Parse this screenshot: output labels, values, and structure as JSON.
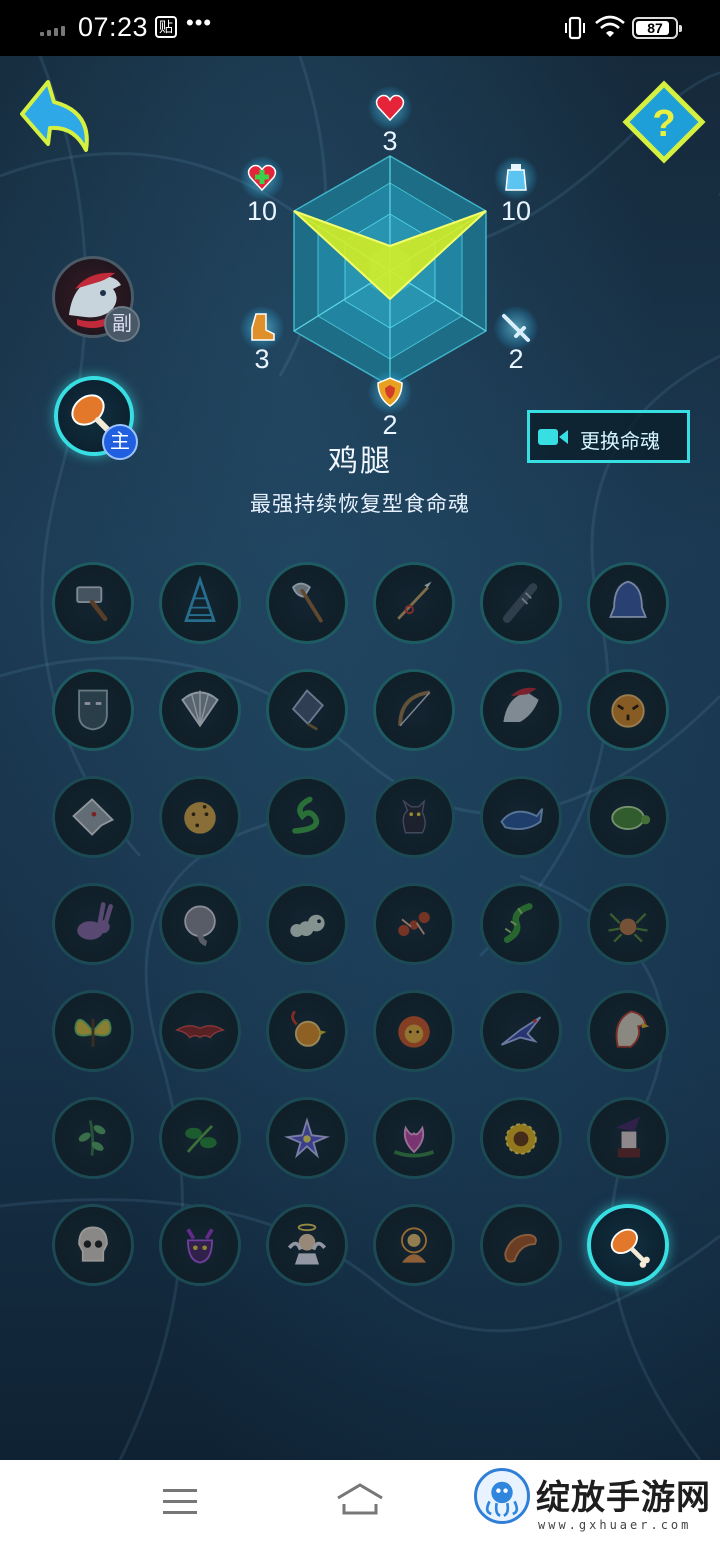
{
  "status_bar": {
    "time": "07:23",
    "tie_icon_label": "贴",
    "more": "•••",
    "battery": "87",
    "battery_fraction": 0.87
  },
  "stats": {
    "hp": "3",
    "mana": "10",
    "attack": "2",
    "defense": "2",
    "speed": "3",
    "regen": "10"
  },
  "soul_slots": {
    "sub_badge": "副",
    "main_badge": "主"
  },
  "swap_button": {
    "label": "更换命魂"
  },
  "selected_soul": {
    "name": "鸡腿",
    "description": "最强持续恢复型食命魂"
  },
  "soul_grid": {
    "rows": [
      [
        "hammer",
        "tree",
        "axe",
        "spear",
        "club",
        "bell"
      ],
      [
        "mask",
        "shell",
        "fan",
        "bow",
        "dragon",
        "tiger"
      ],
      [
        "wolf",
        "leopard",
        "snake",
        "cat",
        "whale",
        "turtle"
      ],
      [
        "rabbit",
        "elephant",
        "worm",
        "ant",
        "centipede",
        "spider"
      ],
      [
        "butterfly",
        "bat",
        "phoenix-chick",
        "lion-flame",
        "swallow",
        "eagle"
      ],
      [
        "vine",
        "rose",
        "lily",
        "lotus",
        "sunflower",
        "witch"
      ],
      [
        "skull",
        "demon",
        "angel",
        "buddha",
        "sausage",
        "chicken-leg"
      ]
    ],
    "selected": "chicken-leg"
  },
  "nav_bar": {
    "items": [
      "menu",
      "home"
    ]
  },
  "watermark": {
    "title": "绽放手游网",
    "url": "www.gxhuaer.com"
  },
  "colors": {
    "accent": "#38dfe2",
    "background": "#1b3850",
    "radar_fill": "#d8f020",
    "main_badge": "#1f5fe0"
  }
}
